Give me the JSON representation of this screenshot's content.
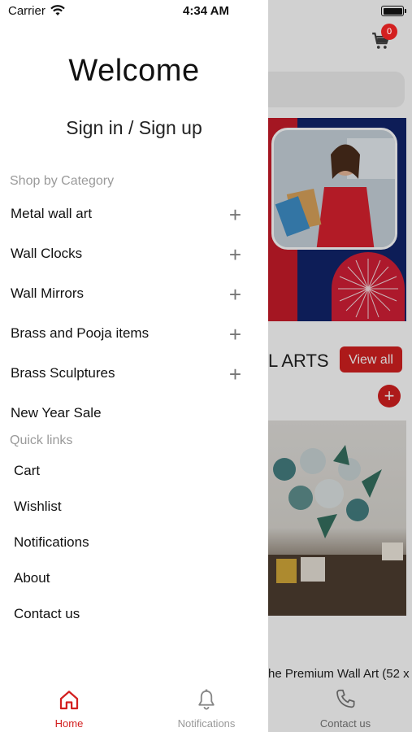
{
  "status_bar": {
    "carrier": "Carrier",
    "time": "4:34 AM"
  },
  "background": {
    "cart_count": "0",
    "section_title": "L ARTS",
    "view_all_label": "View all",
    "plus_symbol": "+",
    "product_title": "he Premium Wall Art (52 x",
    "tab_contact_label": "Contact us"
  },
  "drawer": {
    "welcome": "Welcome",
    "signin": "Sign in / Sign up",
    "shop_by_category_label": "Shop by Category",
    "categories": [
      {
        "label": "Metal wall art",
        "expandable": true
      },
      {
        "label": "Wall Clocks",
        "expandable": true
      },
      {
        "label": "Wall Mirrors",
        "expandable": true
      },
      {
        "label": "Brass and Pooja items",
        "expandable": true
      },
      {
        "label": "Brass Sculptures",
        "expandable": true
      },
      {
        "label": "New Year Sale",
        "expandable": false
      }
    ],
    "expand_symbol": "+",
    "quick_links_label": "Quick links",
    "quick_links": [
      "Cart",
      "Wishlist",
      "Notifications",
      "About",
      "Contact us"
    ]
  },
  "tabbar": {
    "home_label": "Home",
    "notifications_label": "Notifications"
  },
  "colors": {
    "accent": "#d32020",
    "muted": "#9a9a9a",
    "navy": "#11246b"
  }
}
